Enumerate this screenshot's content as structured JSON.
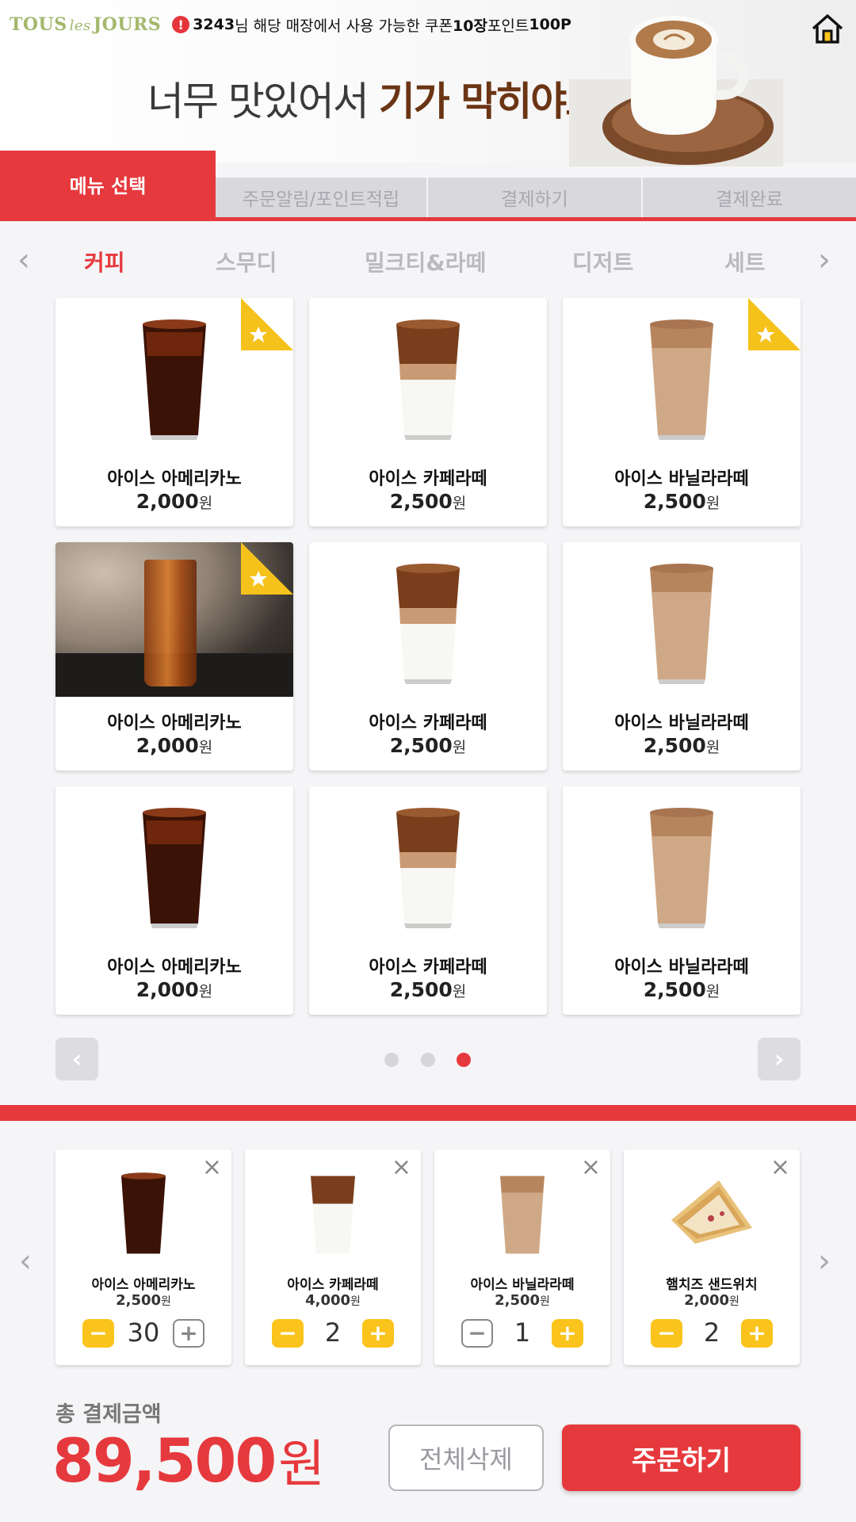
{
  "header": {
    "brand": {
      "left": "TOUS",
      "mid": "les",
      "right": "JOURS"
    },
    "notice": {
      "alert_glyph": "!",
      "points_id": "3243",
      "text_a": "님 해당 매장에서 사용 가능한 쿠폰 ",
      "coupon_count": "10장",
      "text_b": " 포인트 ",
      "points": "100P"
    },
    "home_icon": "home-icon"
  },
  "banner": {
    "text_plain": "너무 맛있어서 ",
    "text_accent": "기가 막히야또"
  },
  "steps": [
    "메뉴 선택",
    "주문알림/포인트적립",
    "결제하기",
    "결제완료"
  ],
  "categories": {
    "items": [
      "커피",
      "스무디",
      "밀크티&라떼",
      "디저트",
      "세트"
    ],
    "active": "커피",
    "prev_glyph": "‹",
    "next_glyph": "›"
  },
  "menu": [
    {
      "name": "아이스 아메리카노",
      "price": "2,000",
      "unit": "원",
      "featured": true
    },
    {
      "name": "아이스 카페라떼",
      "price": "2,500",
      "unit": "원",
      "featured": false
    },
    {
      "name": "아이스 바닐라라떼",
      "price": "2,500",
      "unit": "원",
      "featured": true
    },
    {
      "name": "아이스 아메리카노",
      "price": "2,000",
      "unit": "원",
      "featured": true
    },
    {
      "name": "아이스 카페라떼",
      "price": "2,500",
      "unit": "원",
      "featured": false
    },
    {
      "name": "아이스 바닐라라떼",
      "price": "2,500",
      "unit": "원",
      "featured": false
    },
    {
      "name": "아이스 아메리카노",
      "price": "2,000",
      "unit": "원",
      "featured": false
    },
    {
      "name": "아이스 카페라떼",
      "price": "2,500",
      "unit": "원",
      "featured": false
    },
    {
      "name": "아이스 바닐라라떼",
      "price": "2,500",
      "unit": "원",
      "featured": false
    }
  ],
  "pager": {
    "prev_glyph": "‹",
    "next_glyph": "›",
    "pages": 3,
    "current": 3
  },
  "cart": {
    "prev_glyph": "‹",
    "next_glyph": "›",
    "remove_glyph": "×",
    "minus_glyph": "−",
    "plus_glyph": "+",
    "items": [
      {
        "name": "아이스 아메리카노",
        "price": "2,500",
        "unit": "원",
        "qty": "30",
        "minus_active": true,
        "plus_active": false
      },
      {
        "name": "아이스 카페라떼",
        "price": "4,000",
        "unit": "원",
        "qty": "2",
        "minus_active": true,
        "plus_active": true
      },
      {
        "name": "아이스 바닐라라떼",
        "price": "2,500",
        "unit": "원",
        "qty": "1",
        "minus_active": false,
        "plus_active": true
      },
      {
        "name": "햄치즈 샌드위치",
        "price": "2,000",
        "unit": "원",
        "qty": "2",
        "minus_active": true,
        "plus_active": true
      }
    ]
  },
  "total": {
    "label": "총 결제금액",
    "amount": "89,500",
    "unit": "원"
  },
  "actions": {
    "clear_label": "전체삭제",
    "order_label": "주문하기"
  },
  "colors": {
    "accent": "#e6393d",
    "qty_button": "#fbc41c",
    "brand": "#a4b86d",
    "star_fold": "#fbc41c"
  }
}
